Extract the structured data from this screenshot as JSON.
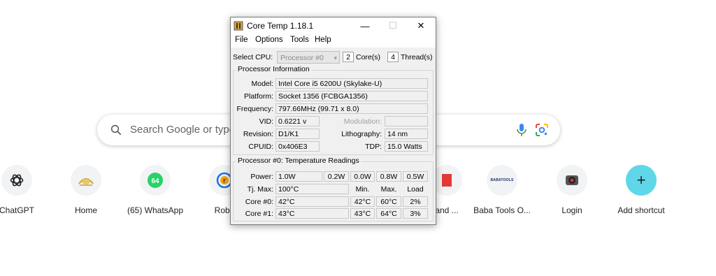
{
  "newtab": {
    "search_placeholder": "Search Google or type",
    "shortcuts": [
      {
        "label": "ChatGPT",
        "icon": "chatgpt-icon"
      },
      {
        "label": "Home",
        "icon": "home-logo-icon"
      },
      {
        "label": "(65) WhatsApp",
        "icon": "whatsapp-icon",
        "badge": "64"
      },
      {
        "label": "Robu",
        "icon": "robu-icon"
      },
      {
        "label": "and ...",
        "icon": "red-site-icon"
      },
      {
        "label": "Baba Tools O...",
        "icon": "baba-tools-icon",
        "tile_text": "BABATOOLS"
      },
      {
        "label": "Login",
        "icon": "login-camera-icon"
      },
      {
        "label": "Add shortcut",
        "icon": "plus-icon",
        "glyph": "+"
      }
    ]
  },
  "coretemp": {
    "title": "Core Temp 1.18.1",
    "controls": {
      "minimize": "—",
      "maximize": "☐",
      "close": "✕"
    },
    "menu": [
      "File",
      "Options",
      "Tools",
      "Help"
    ],
    "select_cpu_label": "Select CPU:",
    "selected_cpu": "Processor #0",
    "cores_value": "2",
    "cores_label": "Core(s)",
    "threads_value": "4",
    "threads_label": "Thread(s)",
    "info": {
      "section_title": "Processor Information",
      "model_label": "Model:",
      "model": "Intel Core i5 6200U (Skylake-U)",
      "platform_label": "Platform:",
      "platform": "Socket 1356 (FCBGA1356)",
      "frequency_label": "Frequency:",
      "frequency": "797.66MHz (99.71 x 8.0)",
      "vid_label": "VID:",
      "vid": "0.6221 v",
      "modulation_label": "Modulation:",
      "modulation": "",
      "revision_label": "Revision:",
      "revision": "D1/K1",
      "lithography_label": "Lithography:",
      "lithography": "14 nm",
      "cpuid_label": "CPUID:",
      "cpuid": "0x406E3",
      "tdp_label": "TDP:",
      "tdp": "15.0 Watts"
    },
    "temps": {
      "section_title": "Processor #0: Temperature Readings",
      "power_label": "Power:",
      "power": [
        "1.0W",
        "0.2W",
        "0.0W",
        "0.8W",
        "0.5W"
      ],
      "tjmax_label": "Tj. Max:",
      "tjmax": "100°C",
      "col_min": "Min.",
      "col_max": "Max.",
      "col_load": "Load",
      "cores": [
        {
          "label": "Core #0:",
          "temp": "42°C",
          "min": "42°C",
          "max": "60°C",
          "load": "2%"
        },
        {
          "label": "Core #1:",
          "temp": "43°C",
          "min": "43°C",
          "max": "64°C",
          "load": "3%"
        }
      ]
    }
  }
}
